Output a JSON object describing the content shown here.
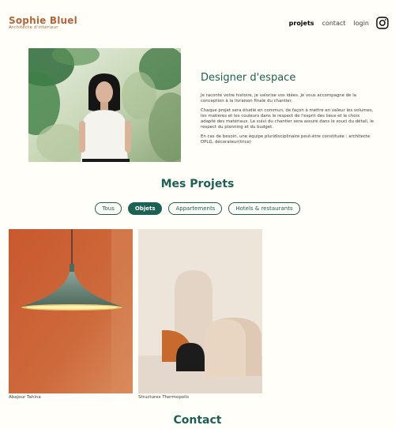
{
  "header": {
    "logo_title": "Sophie Bluel",
    "logo_subtitle": "Architecte d'intérieur",
    "nav": [
      {
        "label": "projets",
        "active": true
      },
      {
        "label": "contact",
        "active": false
      },
      {
        "label": "login",
        "active": false
      }
    ],
    "instagram_icon": "instagram-icon"
  },
  "intro": {
    "title": "Designer d'espace",
    "paragraphs": [
      "Je raconte votre histoire, je valorise vos idées. Je vous accompagne de la conception à la livraison finale du chantier.",
      "Chaque projet sera étudié en commun, de façon à mettre en valeur les volumes, les matières et les couleurs dans le respect de l'esprit des lieux et le choix adapté des matériaux. Le suivi du chantier sera assuré dans le souci du détail, le respect du planning et du budget.",
      "En cas de besoin, une équipe pluridisciplinaire peut-être constituée : architecte DPLG, décorateur(trice)"
    ]
  },
  "projects": {
    "title": "Mes Projets",
    "filters": [
      {
        "label": "Tous",
        "active": false
      },
      {
        "label": "Objets",
        "active": true
      },
      {
        "label": "Appartements",
        "active": false
      },
      {
        "label": "Hotels & restaurants",
        "active": false
      }
    ],
    "items": [
      {
        "caption": "Abajour Tahina"
      },
      {
        "caption": "Structures Thermopolis"
      }
    ]
  },
  "contact": {
    "title": "Contact"
  },
  "colors": {
    "accent": "#1D6154",
    "brand": "#B1663C",
    "background": "#FFFEF8"
  }
}
